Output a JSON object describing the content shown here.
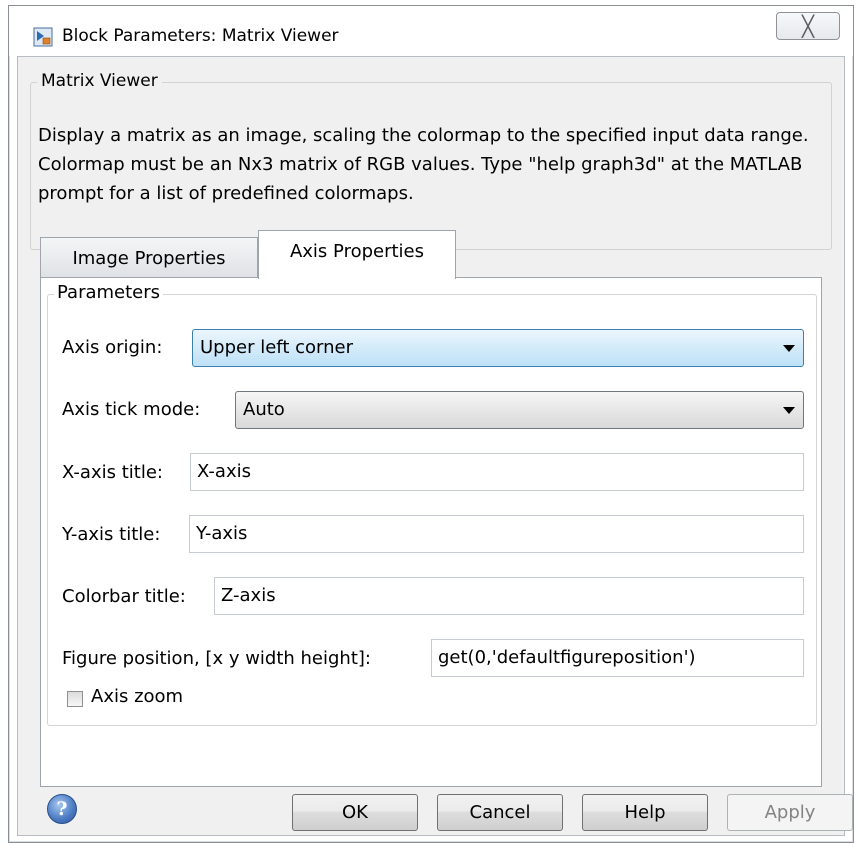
{
  "window": {
    "title": "Block Parameters: Matrix Viewer",
    "close_glyph": "╳",
    "app_icon": "simulink-block-icon"
  },
  "description": {
    "group_title": "Matrix Viewer",
    "text": "Display a matrix as an image, scaling the colormap to the specified input data range.  Colormap must be an Nx3 matrix of RGB values.  Type \"help graph3d\" at the MATLAB prompt for a list of predefined colormaps."
  },
  "tabs": [
    {
      "label": "Image Properties",
      "active": false
    },
    {
      "label": "Axis Properties",
      "active": true
    }
  ],
  "parameters": {
    "group_title": "Parameters",
    "axis_origin": {
      "label": "Axis origin:",
      "value": "Upper left corner"
    },
    "axis_tick_mode": {
      "label": "Axis tick mode:",
      "value": "Auto"
    },
    "x_axis_title": {
      "label": "X-axis title:",
      "value": "X-axis"
    },
    "y_axis_title": {
      "label": "Y-axis title:",
      "value": "Y-axis"
    },
    "colorbar_title": {
      "label": "Colorbar title:",
      "value": "Z-axis"
    },
    "figure_position": {
      "label": "Figure position, [x y width height]:",
      "value": "get(0,'defaultfigureposition')"
    },
    "axis_zoom": {
      "label": "Axis zoom",
      "checked": false
    }
  },
  "buttons": {
    "help_icon_glyph": "?",
    "ok": "OK",
    "cancel": "Cancel",
    "help": "Help",
    "apply": "Apply",
    "apply_enabled": false
  },
  "colors": {
    "accent_focus": "#3c7fb1",
    "dialog_bg": "#f0f0f0",
    "help_icon": "#4f7fc6"
  }
}
